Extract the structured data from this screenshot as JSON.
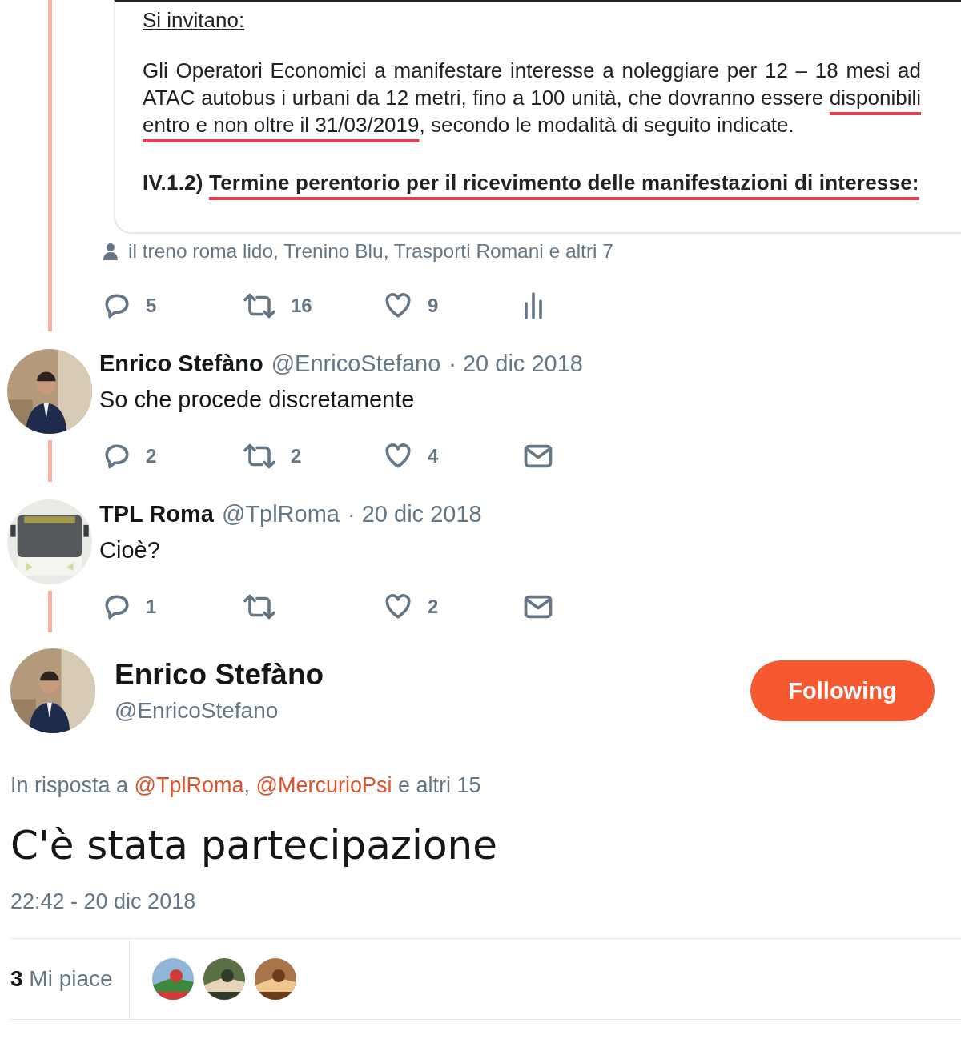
{
  "document": {
    "heading": "Si invitano:",
    "paragraph": {
      "before": "Gli Operatori Economici a manifestare interesse a noleggiare per 12 – 18 mesi ad ATAC  autobus i urbani da 12 metri, fino a 100 unità, che dovranno essere ",
      "highlight": "disponibili entro e non oltre il 31/03/2019",
      "after": ", secondo le modalità di seguito indicate."
    },
    "section": {
      "number": "IV.1.2)",
      "title": "Termine perentorio per il ricevimento delle manifestazioni di interesse:"
    }
  },
  "tagged_users": "il treno roma lido, Trenino Blu, Trasporti Romani e altri 7",
  "actions": [
    {
      "kind": "reply",
      "count": "5"
    },
    {
      "kind": "retweet",
      "count": "16"
    },
    {
      "kind": "like",
      "count": "9"
    },
    {
      "kind": "analytics"
    }
  ],
  "replies": [
    {
      "name": "Enrico Stefàno",
      "handle": "@EnricoStefano",
      "date": "· 20 dic 2018",
      "text": "So che procede discretamente",
      "actions": [
        {
          "kind": "reply",
          "count": "2"
        },
        {
          "kind": "retweet",
          "count": "2"
        },
        {
          "kind": "like",
          "count": "4"
        },
        {
          "kind": "message"
        }
      ]
    },
    {
      "name": "TPL Roma",
      "handle": "@TplRoma",
      "date": "· 20 dic 2018",
      "text": "Cioè?",
      "actions": [
        {
          "kind": "reply",
          "count": "1"
        },
        {
          "kind": "retweet"
        },
        {
          "kind": "like",
          "count": "2"
        },
        {
          "kind": "message"
        }
      ]
    }
  ],
  "main_tweet": {
    "name": "Enrico Stefàno",
    "handle": "@EnricoStefano",
    "follow_button": "Following",
    "reply_to": {
      "prefix": "In risposta a",
      "mentions": [
        "@TplRoma",
        "@MercurioPsi"
      ],
      "separator": ",",
      "suffix": "e altri 15"
    },
    "text": "C'è stata partecipazione",
    "time": "22:42 - 20 dic 2018",
    "likes_count": "3",
    "likes_label": "Mi piace"
  }
}
